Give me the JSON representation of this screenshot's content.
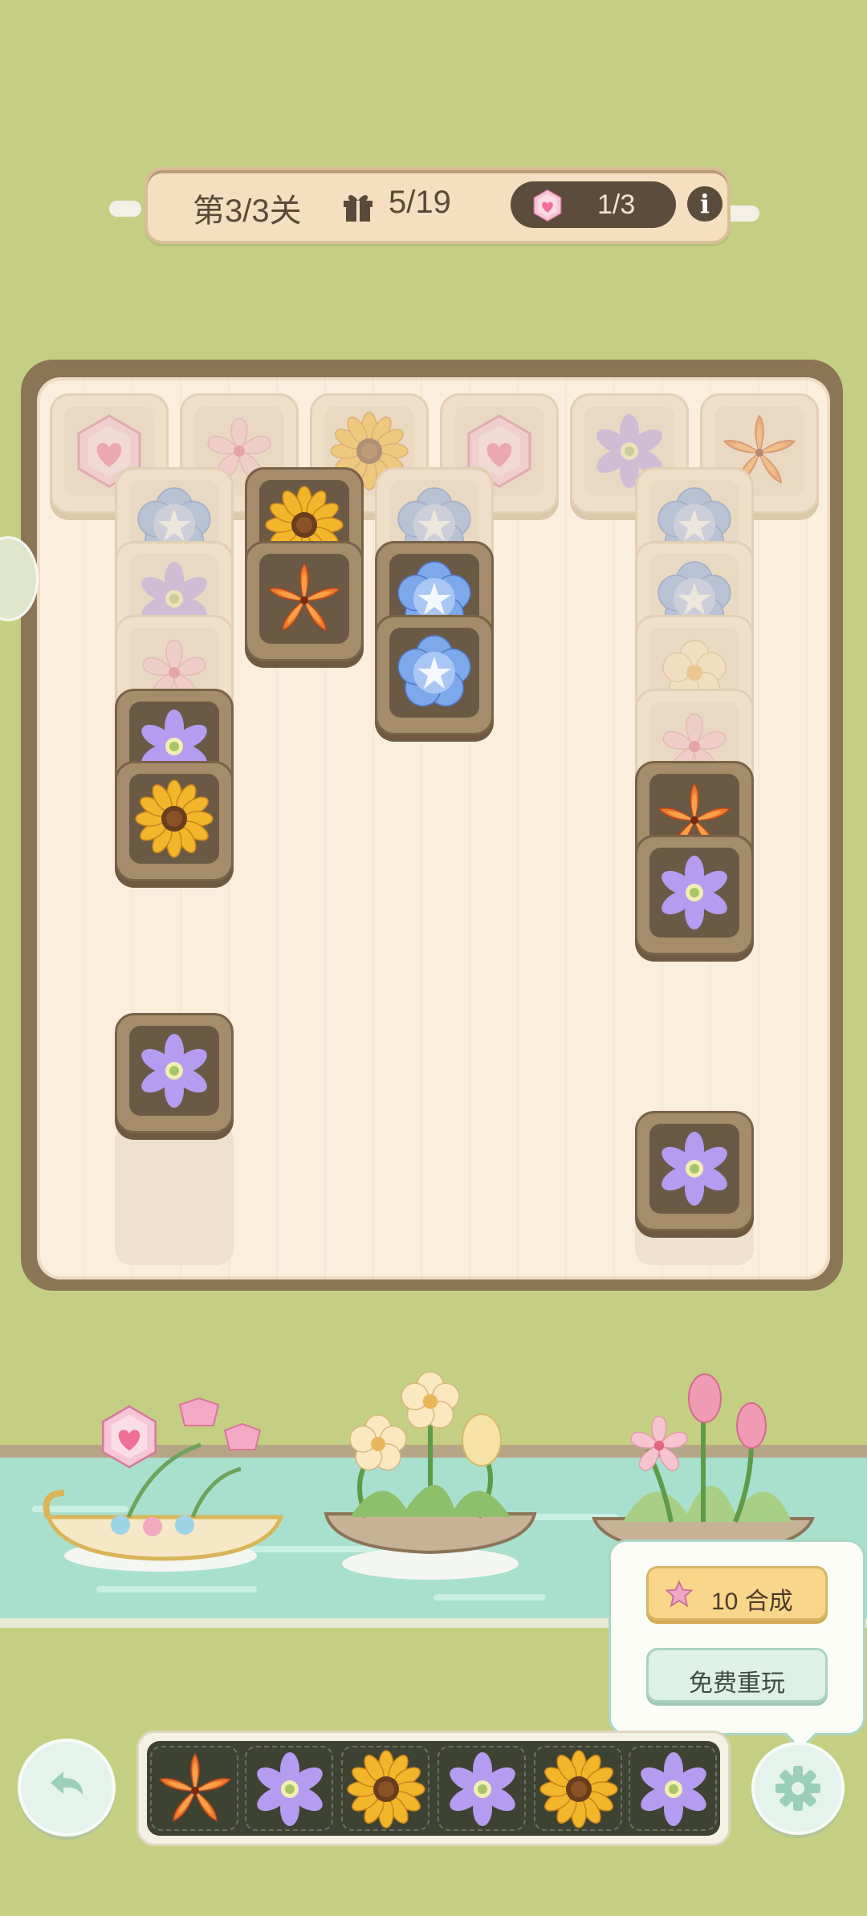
{
  "header": {
    "level": "第3/3关",
    "moves": "5/19",
    "gems": "1/3",
    "gift_icon": "gift-icon",
    "info_icon": "info-icon",
    "info_symbol": "i"
  },
  "board": {
    "tiles_flower_types": [
      "gem",
      "cherry",
      "sunflower",
      "blue-flower",
      "purple-clematis",
      "orange-lily",
      "cream-flower"
    ]
  },
  "tray": {
    "slots": [
      "orange-lily",
      "purple-clematis",
      "sunflower",
      "purple-clematis",
      "sunflower",
      "purple-clematis"
    ]
  },
  "popup": {
    "merge_cost": "10",
    "merge_label": "合成",
    "replay_label": "免费重玩"
  },
  "controls": {
    "undo_icon": "undo-icon",
    "settings_icon": "settings-icon"
  },
  "colors": {
    "background": "#c5cf83",
    "board_frame": "#8c7457",
    "board": "#fbeedd",
    "tile_dark": "#6a5a45",
    "river": "#a9e0cd",
    "merge_button": "#f8d78a",
    "replay_button": "#ddf1e7"
  }
}
